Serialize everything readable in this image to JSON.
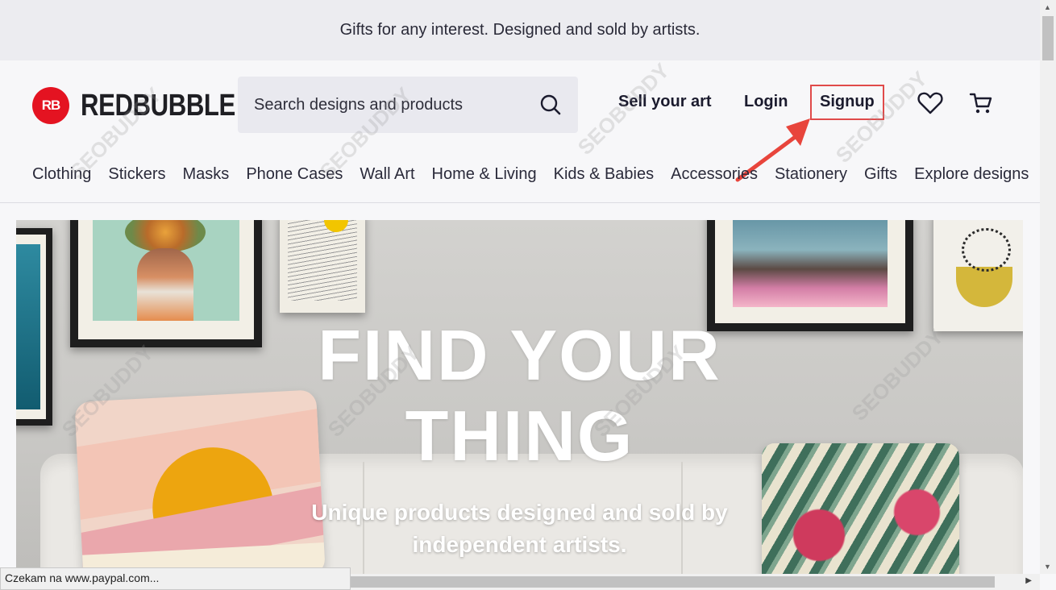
{
  "banner": {
    "text": "Gifts for any interest. Designed and sold by artists."
  },
  "header": {
    "logo_badge": "RB",
    "logo_text": "REDBUBBLE",
    "search": {
      "placeholder": "Search designs and products",
      "value": ""
    },
    "links": {
      "sell": "Sell your art",
      "login": "Login",
      "signup": "Signup"
    },
    "icons": [
      "search-icon",
      "heart-icon",
      "cart-icon"
    ]
  },
  "categories": [
    "Clothing",
    "Stickers",
    "Masks",
    "Phone Cases",
    "Wall Art",
    "Home & Living",
    "Kids & Babies",
    "Accessories",
    "Stationery",
    "Gifts",
    "Explore designs"
  ],
  "hero": {
    "title_line1": "FIND YOUR",
    "title_line2": "THING",
    "subtitle_line1": "Unique products designed and sold by",
    "subtitle_line2": "independent artists."
  },
  "watermark": "SEOBUDDY",
  "status_bar": {
    "text": "Czekam na www.paypal.com..."
  },
  "colors": {
    "brand": "#e41321",
    "highlight_box": "#e04a4a",
    "arrow": "#e8453c"
  }
}
